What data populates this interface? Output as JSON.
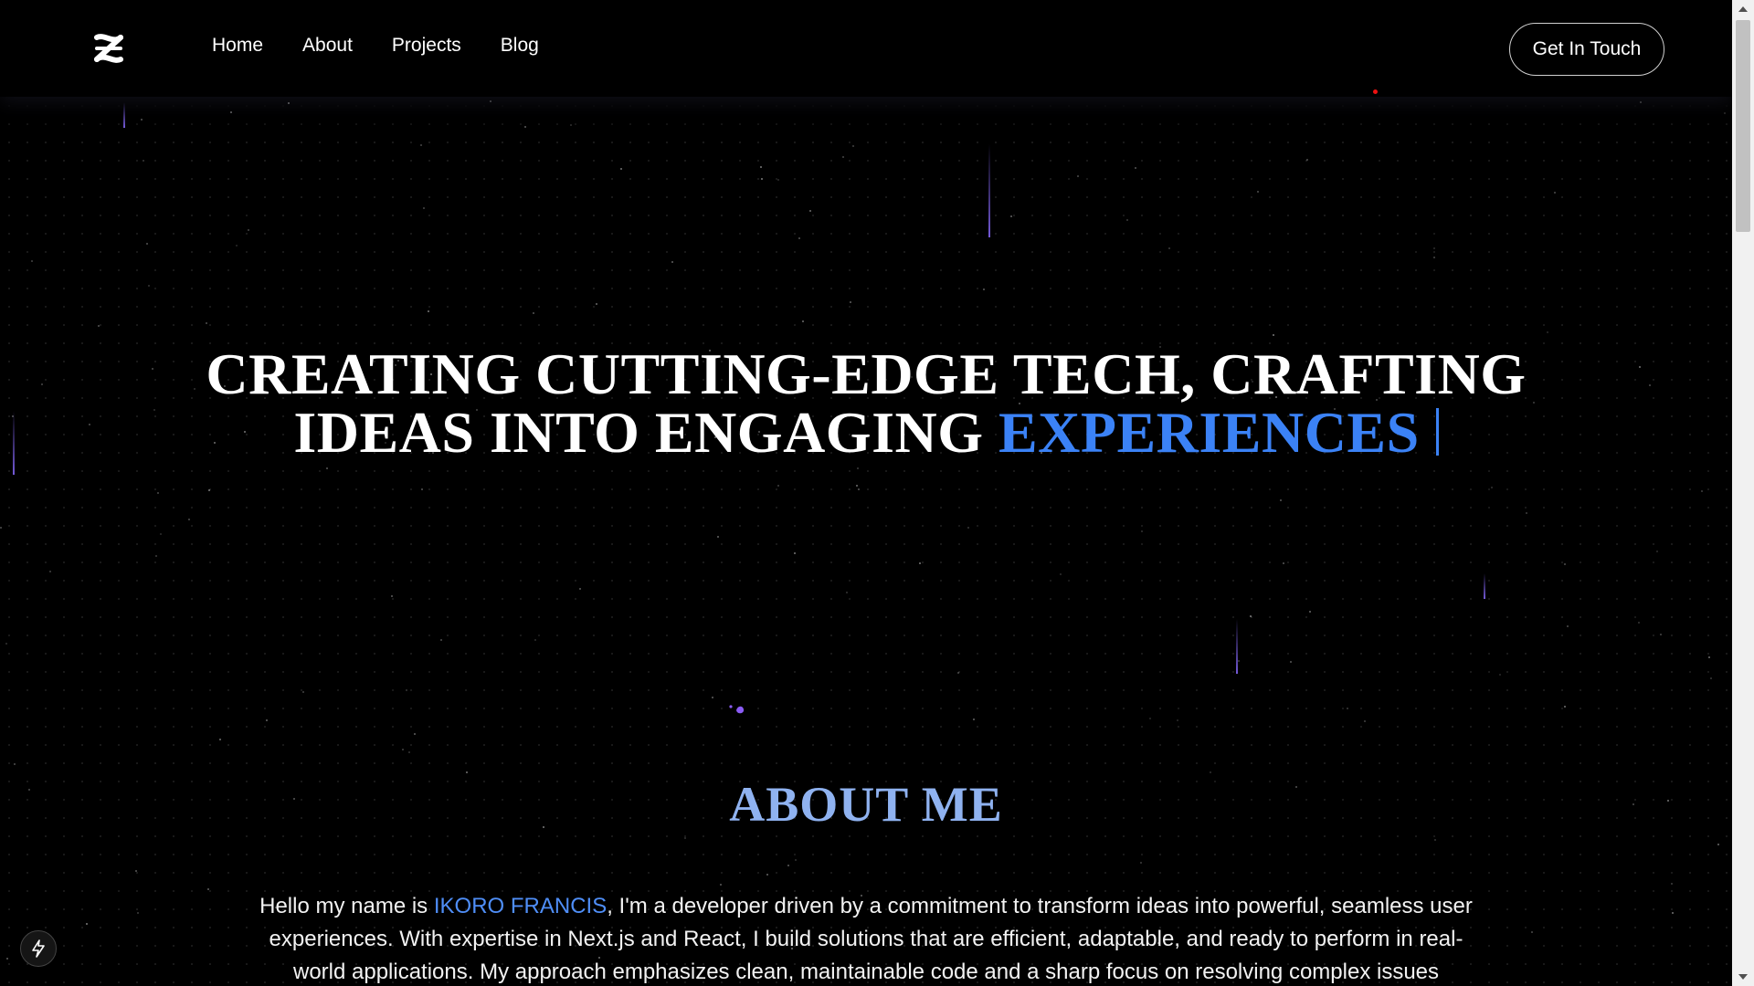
{
  "nav": {
    "links": [
      "Home",
      "About",
      "Projects",
      "Blog"
    ],
    "cta_label": "Get In Touch"
  },
  "hero": {
    "line1": "CREATING CUTTING-EDGE TECH, CRAFTING",
    "line2_prefix": "IDEAS INTO ENGAGING ",
    "line2_accent": "EXPERIENCES"
  },
  "about": {
    "title": "ABOUT ME",
    "intro": "Hello my name is ",
    "name": "IKORO FRANCIS",
    "body": ", I'm a developer driven by a commitment to transform ideas into powerful, seamless user experiences. With expertise in Next.js and React, I build solutions that are efficient, adaptable, and ready to perform in real-world applications. My approach emphasizes clean, maintainable code and a sharp focus on resolving complex issues"
  },
  "colors": {
    "accent": "#3b82f6",
    "about_title": "#8fb2f0",
    "background": "#000000"
  },
  "icons": {
    "logo": "logo-icon",
    "float_button": "lightning-icon",
    "scroll_up": "arrow-up-icon",
    "scroll_down": "arrow-down-icon"
  }
}
